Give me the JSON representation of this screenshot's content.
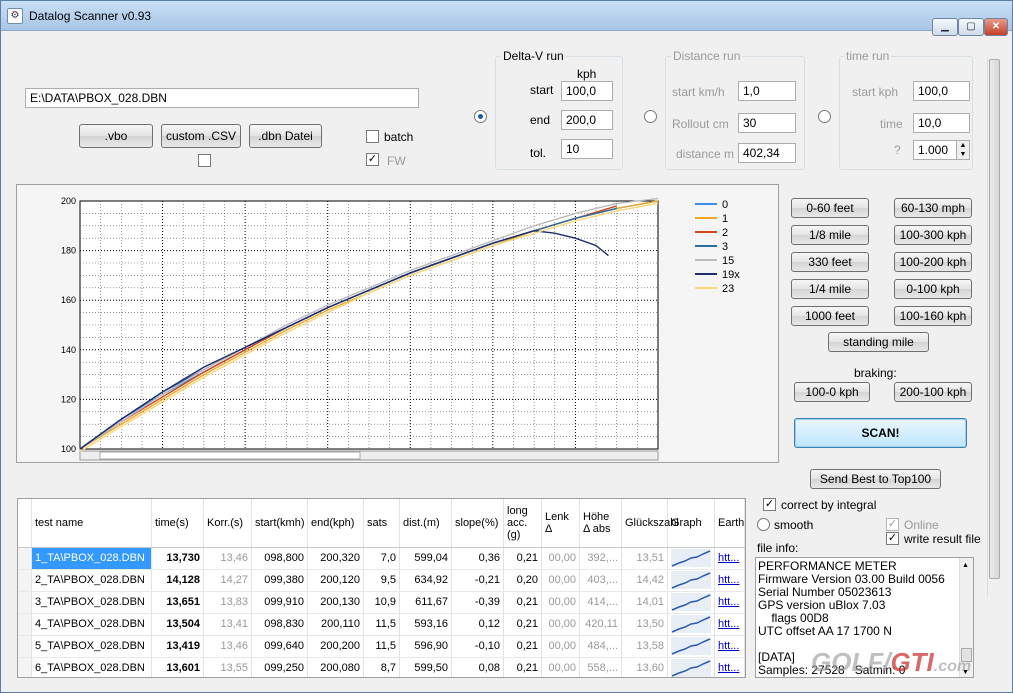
{
  "window": {
    "title": "Datalog Scanner v0.93"
  },
  "file": {
    "path": "E:\\DATA\\PBOX_028.DBN"
  },
  "load_buttons": {
    "vbo": ".vbo",
    "csv": "custom .CSV",
    "dbn": ".dbn Datei"
  },
  "options": {
    "batch": "batch",
    "fw": "FW"
  },
  "deltav": {
    "title": "Delta-V run",
    "unit": "kph",
    "start_label": "start",
    "start": "100,0",
    "end_label": "end",
    "end": "200,0",
    "tol_label": "tol.",
    "tol": "10"
  },
  "distance": {
    "title": "Distance run",
    "start_label": "start km/h",
    "start": "1,0",
    "rollout_label": "Rollout cm",
    "rollout": "30",
    "distance_label": "distance m",
    "distance": "402,34"
  },
  "time": {
    "title": "time run",
    "start_label": "start kph",
    "start": "100,0",
    "time_label": "time",
    "time": "10,0",
    "q_label": "?",
    "q": "1.000"
  },
  "presets": [
    "0-60 feet",
    "60-130 mph",
    "1/8 mile",
    "100-300 kph",
    "330 feet",
    "100-200 kph",
    "1/4 mile",
    "0-100 kph",
    "1000 feet",
    "100-160 kph"
  ],
  "standing_mile": "standing mile",
  "braking": {
    "label": "braking:",
    "b1": "100-0 kph",
    "b2": "200-100 kph"
  },
  "scan": "SCAN!",
  "send_best": "Send Best to Top100",
  "flags": {
    "correct": "correct by integral",
    "smooth": "smooth",
    "online": "Online",
    "write": "write result file"
  },
  "info": {
    "label": "file info:",
    "lines": [
      "PERFORMANCE METER",
      "Firmware Version 03.00 Build 0056",
      "Serial Number 05023613",
      "GPS version uBlox 7.03",
      "    flags 00D8",
      "UTC offset AA 17 1700 N",
      "",
      "[DATA]",
      "Samples: 27528   Satmin: 0"
    ]
  },
  "watermark": {
    "a": "GOLF",
    "b": "GTI",
    ".c": ".com",
    "c": ".com"
  },
  "chart_data": {
    "type": "line",
    "xlim": [
      0,
      14
    ],
    "ylim": [
      100,
      200
    ],
    "xticks": [
      "0",
      "2",
      "4",
      "6",
      "8",
      "10",
      "12",
      "14"
    ],
    "yticks": [
      "100",
      "120",
      "140",
      "160",
      "180",
      "200"
    ],
    "legend_position": "top-right",
    "series": [
      {
        "name": "0",
        "color": "#3c8ee6",
        "x": [
          0,
          1,
          2,
          3,
          4,
          5,
          6,
          7,
          8,
          9,
          10,
          11,
          12,
          13,
          14
        ],
        "y": [
          100,
          112,
          122,
          131,
          140,
          149,
          157,
          164,
          171,
          177,
          183,
          188,
          193,
          197,
          200
        ]
      },
      {
        "name": "1",
        "color": "#f0a828",
        "x": [
          0,
          1,
          2,
          3,
          4,
          5,
          6,
          7,
          8,
          9,
          10,
          11,
          12,
          13,
          14
        ],
        "y": [
          100,
          110,
          120,
          130,
          139,
          148,
          156,
          163,
          170,
          176,
          182,
          188,
          193,
          197,
          200
        ]
      },
      {
        "name": "2",
        "color": "#d4431c",
        "x": [
          0,
          1,
          2,
          3,
          4,
          5,
          6,
          7,
          8,
          9,
          10,
          11,
          12,
          13
        ],
        "y": [
          100,
          111,
          121,
          131,
          140,
          149,
          157,
          164,
          171,
          177,
          183,
          188,
          193,
          198
        ]
      },
      {
        "name": "3",
        "color": "#2a6e9e",
        "x": [
          0,
          1,
          2,
          3,
          4,
          5,
          6,
          7,
          8,
          9,
          10,
          11,
          12,
          13
        ],
        "y": [
          100,
          112,
          123,
          132,
          141,
          149,
          157,
          164,
          171,
          177,
          183,
          188,
          193,
          197
        ]
      },
      {
        "name": "15",
        "color": "#bcbcbc",
        "x": [
          0,
          1,
          2,
          3,
          4,
          5,
          6,
          7,
          8,
          9,
          10,
          11,
          12,
          13,
          14
        ],
        "y": [
          100,
          111,
          122,
          132,
          141,
          150,
          158,
          165,
          172,
          178,
          184,
          190,
          195,
          199,
          201
        ]
      },
      {
        "name": "19x",
        "color": "#1c2e6e",
        "x": [
          0,
          1,
          2,
          3,
          4,
          5,
          6,
          7,
          8,
          9,
          10,
          11,
          11.5,
          12,
          12.5,
          12.8
        ],
        "y": [
          100,
          112,
          123,
          133,
          141,
          149,
          157,
          164,
          171,
          177,
          183,
          188,
          187,
          185,
          182,
          178
        ]
      },
      {
        "name": "23",
        "color": "#f7d87a",
        "x": [
          0,
          1,
          2,
          3,
          4,
          5,
          6,
          7,
          8,
          9,
          10,
          11,
          12,
          13,
          14
        ],
        "y": [
          99,
          109,
          119,
          129,
          138,
          147,
          155,
          163,
          170,
          176,
          182,
          187,
          192,
          196,
          199
        ]
      }
    ]
  },
  "table": {
    "headers": [
      "test name",
      "time(s)",
      "Korr.(s)",
      "start(kmh)",
      "end(kph)",
      "sats",
      "dist.(m)",
      "slope(%)",
      "long acc.(g)",
      "Lenk Δ",
      "Höhe Δ abs",
      "Glückszahl",
      "Graph",
      "Earth"
    ],
    "rows": [
      [
        "1_TA\\PBOX_028.DBN",
        "13,730",
        "13,46",
        "098,800",
        "200,320",
        "7,0",
        "599,04",
        "0,36",
        "0,21",
        "00,00",
        "392,...",
        "13,51",
        "htt..."
      ],
      [
        "2_TA\\PBOX_028.DBN",
        "14,128",
        "14,27",
        "099,380",
        "200,120",
        "9,5",
        "634,92",
        "-0,21",
        "0,20",
        "00,00",
        "403,...",
        "14,42",
        "htt..."
      ],
      [
        "3_TA\\PBOX_028.DBN",
        "13,651",
        "13,83",
        "099,910",
        "200,130",
        "10,9",
        "611,67",
        "-0,39",
        "0,21",
        "00,00",
        "414,...",
        "14,01",
        "htt..."
      ],
      [
        "4_TA\\PBOX_028.DBN",
        "13,504",
        "13,41",
        "098,830",
        "200,110",
        "11,5",
        "593,16",
        "0,12",
        "0,21",
        "00,00",
        "420,11",
        "13,50",
        "htt..."
      ],
      [
        "5_TA\\PBOX_028.DBN",
        "13,419",
        "13,46",
        "099,640",
        "200,200",
        "11,5",
        "596,90",
        "-0,10",
        "0,21",
        "00,00",
        "484,...",
        "13,58",
        "htt..."
      ],
      [
        "6_TA\\PBOX_028.DBN",
        "13,601",
        "13,55",
        "099,250",
        "200,080",
        "8,7",
        "599,50",
        "0,08",
        "0,21",
        "00,00",
        "558,...",
        "13,60",
        "htt..."
      ]
    ]
  }
}
